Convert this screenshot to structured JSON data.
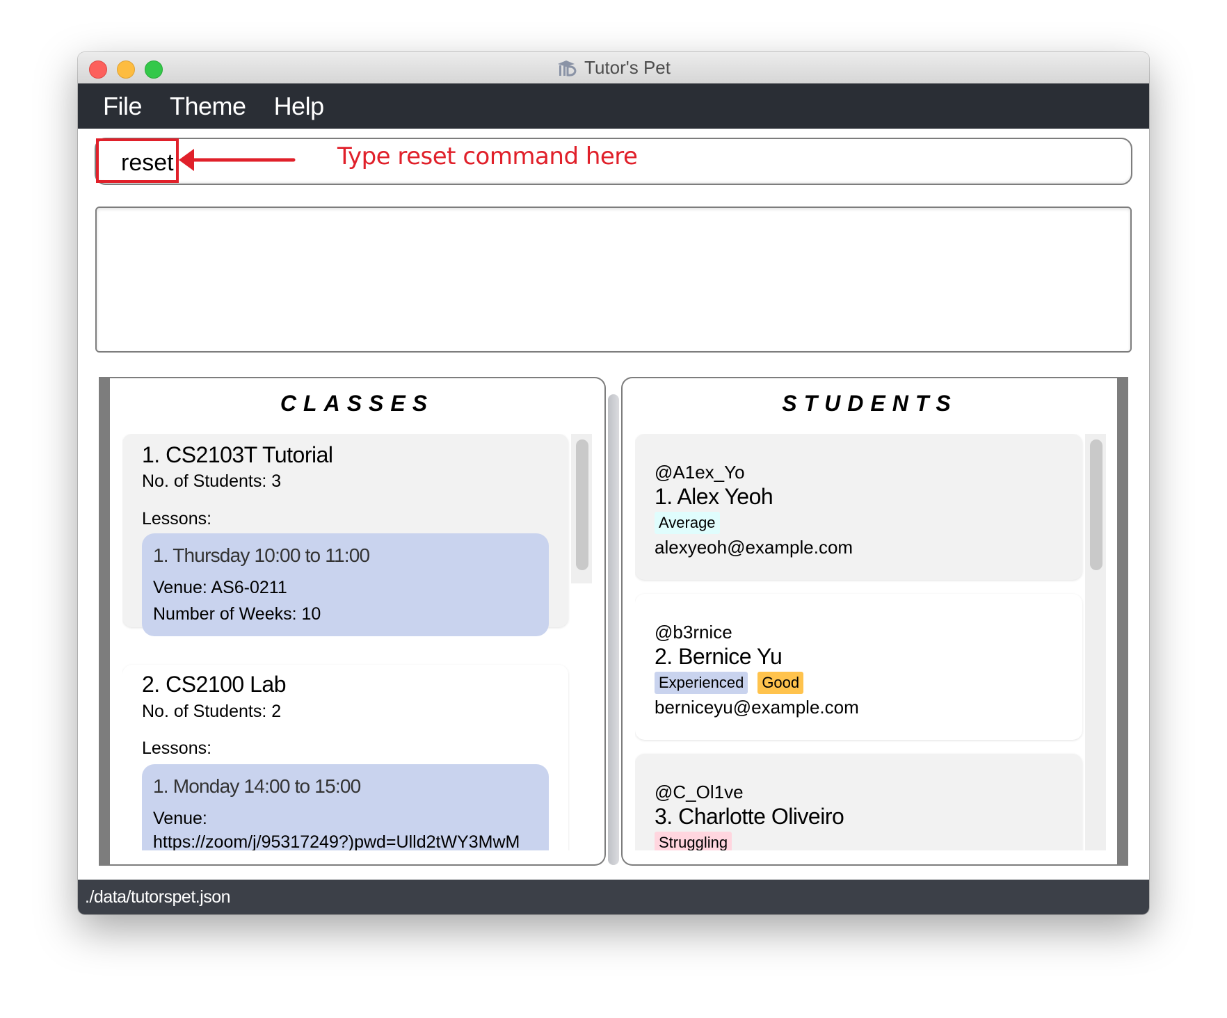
{
  "window": {
    "title": "Tutor's Pet",
    "title_icon": "mortarboard-pet-icon"
  },
  "menubar": {
    "items": [
      {
        "label": "File"
      },
      {
        "label": "Theme"
      },
      {
        "label": "Help"
      }
    ]
  },
  "command": {
    "value": "reset",
    "annotation": "Type reset command here",
    "annotation_color": "#e0202a"
  },
  "result": {
    "text": ""
  },
  "classes": {
    "title": "CLASSES",
    "items": [
      {
        "title": "1.  CS2103T Tutorial",
        "students": "No. of Students:  3",
        "lessons_label": "Lessons:",
        "lessons": [
          {
            "head": "1. Thursday 10:00 to 11:00",
            "venue": "Venue:  AS6-0211",
            "weeks": "Number of Weeks:  10"
          }
        ]
      },
      {
        "title": "2.  CS2100 Lab",
        "students": "No. of Students:  2",
        "lessons_label": "Lessons:",
        "lessons": [
          {
            "head": "1. Monday 14:00 to 15:00",
            "venue": "Venue:",
            "venue_value": "https://zoom/j/95317249?)pwd=Ulld2tWY3MwM"
          }
        ]
      }
    ]
  },
  "students": {
    "title": "STUDENTS",
    "items": [
      {
        "handle": "@A1ex_Yo",
        "name": "1.  Alex Yeoh",
        "tags": [
          {
            "label": "Average",
            "color": "#e0fdfd"
          }
        ],
        "email": "alexyeoh@example.com"
      },
      {
        "handle": "@b3rnice",
        "name": "2.  Bernice Yu",
        "tags": [
          {
            "label": "Experienced",
            "color": "#c9d3ee"
          },
          {
            "label": "Good",
            "color": "#ffc34d"
          }
        ],
        "email": "berniceyu@example.com"
      },
      {
        "handle": "@C_Ol1ve",
        "name": "3.  Charlotte Oliveiro",
        "tags": [
          {
            "label": "Struggling",
            "color": "#ffd6df"
          }
        ]
      }
    ]
  },
  "status": {
    "path": "./data/tutorspet.json"
  }
}
